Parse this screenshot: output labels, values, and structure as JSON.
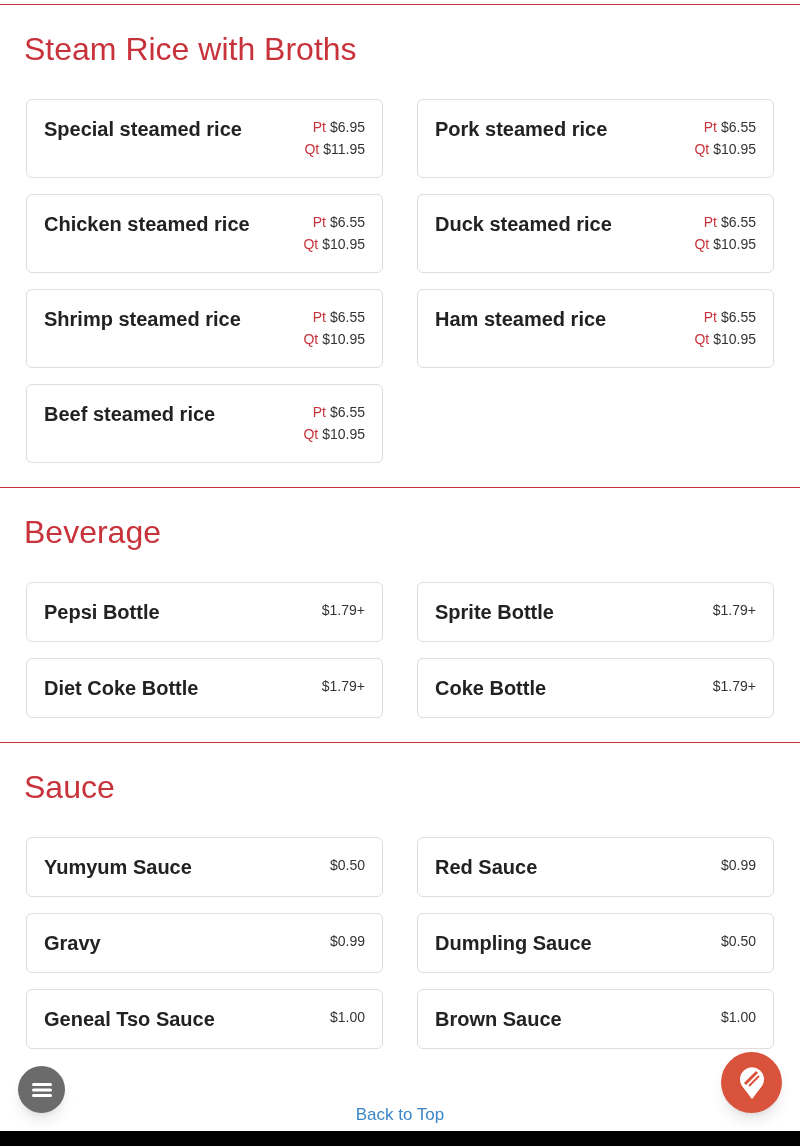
{
  "sections": [
    {
      "title": "Steam Rice with Broths",
      "items": [
        {
          "name": "Special steamed rice",
          "kind": "sizes",
          "prices": [
            {
              "size": "Pt",
              "amount": "$6.95"
            },
            {
              "size": "Qt",
              "amount": "$11.95"
            }
          ]
        },
        {
          "name": "Pork steamed rice",
          "kind": "sizes",
          "prices": [
            {
              "size": "Pt",
              "amount": "$6.55"
            },
            {
              "size": "Qt",
              "amount": "$10.95"
            }
          ]
        },
        {
          "name": "Chicken steamed rice",
          "kind": "sizes",
          "prices": [
            {
              "size": "Pt",
              "amount": "$6.55"
            },
            {
              "size": "Qt",
              "amount": "$10.95"
            }
          ]
        },
        {
          "name": "Duck steamed rice",
          "kind": "sizes",
          "prices": [
            {
              "size": "Pt",
              "amount": "$6.55"
            },
            {
              "size": "Qt",
              "amount": "$10.95"
            }
          ]
        },
        {
          "name": "Shrimp steamed rice",
          "kind": "sizes",
          "prices": [
            {
              "size": "Pt",
              "amount": "$6.55"
            },
            {
              "size": "Qt",
              "amount": "$10.95"
            }
          ]
        },
        {
          "name": "Ham steamed rice",
          "kind": "sizes",
          "prices": [
            {
              "size": "Pt",
              "amount": "$6.55"
            },
            {
              "size": "Qt",
              "amount": "$10.95"
            }
          ]
        },
        {
          "name": "Beef steamed rice",
          "kind": "sizes",
          "prices": [
            {
              "size": "Pt",
              "amount": "$6.55"
            },
            {
              "size": "Qt",
              "amount": "$10.95"
            }
          ]
        }
      ]
    },
    {
      "title": "Beverage",
      "items": [
        {
          "name": "Pepsi Bottle",
          "kind": "single",
          "price": "$1.79+"
        },
        {
          "name": "Sprite Bottle",
          "kind": "single",
          "price": "$1.79+"
        },
        {
          "name": "Diet Coke Bottle",
          "kind": "single",
          "price": "$1.79+"
        },
        {
          "name": "Coke Bottle",
          "kind": "single",
          "price": "$1.79+"
        }
      ]
    },
    {
      "title": "Sauce",
      "items": [
        {
          "name": "Yumyum Sauce",
          "kind": "single",
          "price": "$0.50"
        },
        {
          "name": "Red Sauce",
          "kind": "single",
          "price": "$0.99"
        },
        {
          "name": "Gravy",
          "kind": "single",
          "price": "$0.99"
        },
        {
          "name": "Dumpling Sauce",
          "kind": "single",
          "price": "$0.50"
        },
        {
          "name": "Geneal Tso Sauce",
          "kind": "single",
          "price": "$1.00"
        },
        {
          "name": "Brown Sauce",
          "kind": "single",
          "price": "$1.00"
        }
      ]
    }
  ],
  "back_to_top": "Back to Top"
}
